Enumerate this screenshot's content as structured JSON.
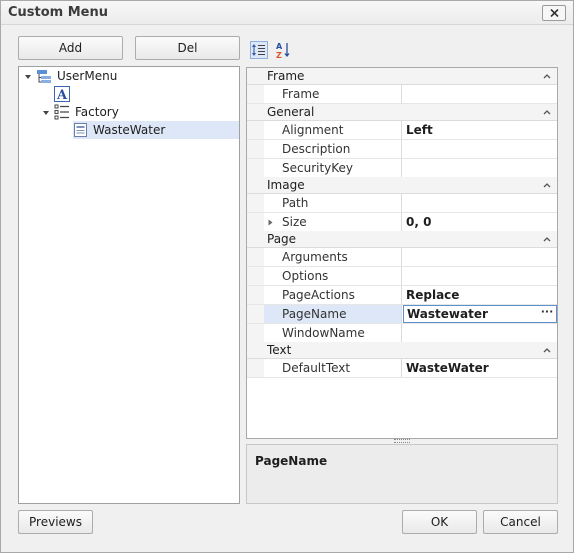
{
  "window": {
    "title": "Custom Menu",
    "close_icon": "close-x-icon"
  },
  "tree_buttons": {
    "add_label": "Add",
    "del_label": "Del"
  },
  "tree": {
    "items": [
      {
        "label": "UserMenu",
        "icon": "menu-root-icon",
        "expanded": true
      },
      {
        "label": "",
        "icon": "text-item-icon"
      },
      {
        "label": "Factory",
        "icon": "submenu-list-icon",
        "expanded": true
      },
      {
        "label": "WasteWater",
        "icon": "page-item-icon",
        "selected": true
      }
    ]
  },
  "toolbar": {
    "categorized_icon": "categorized-sort-icon",
    "alphabetical_icon": "alphabetical-sort-icon",
    "active": "categorized"
  },
  "property_grid": {
    "categories": [
      {
        "label": "Frame",
        "properties": [
          {
            "name": "Frame",
            "value": ""
          }
        ]
      },
      {
        "label": "General",
        "properties": [
          {
            "name": "Alignment",
            "value": "Left"
          },
          {
            "name": "Description",
            "value": ""
          },
          {
            "name": "SecurityKey",
            "value": ""
          }
        ]
      },
      {
        "label": "Image",
        "properties": [
          {
            "name": "Path",
            "value": ""
          },
          {
            "name": "Size",
            "value": "0, 0",
            "expandable": true
          }
        ]
      },
      {
        "label": "Page",
        "properties": [
          {
            "name": "Arguments",
            "value": ""
          },
          {
            "name": "Options",
            "value": ""
          },
          {
            "name": "PageActions",
            "value": "Replace"
          },
          {
            "name": "PageName",
            "value": "Wastewater",
            "selected": true,
            "ellipsis": "···"
          },
          {
            "name": "WindowName",
            "value": ""
          }
        ]
      },
      {
        "label": "Text",
        "properties": [
          {
            "name": "DefaultText",
            "value": "WasteWater"
          }
        ]
      }
    ]
  },
  "description": {
    "title": "PageName"
  },
  "footer": {
    "previews_label": "Previews",
    "ok_label": "OK",
    "cancel_label": "Cancel"
  },
  "colors": {
    "selection": "#dde7f7",
    "selection_border": "#5b8fd6",
    "category_bg": "#f4f4f4"
  }
}
